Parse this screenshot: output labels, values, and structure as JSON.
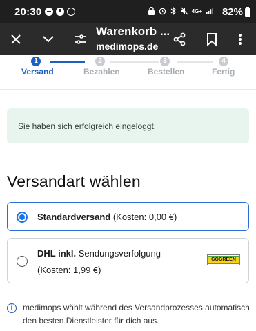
{
  "status_bar": {
    "time": "20:30",
    "network": "4G+",
    "battery": "82%"
  },
  "app_bar": {
    "title": "Warenkorb ...",
    "subtitle": "medimops.de",
    "icons": [
      "close-icon",
      "chevron-down-icon",
      "page-settings-icon",
      "share-icon",
      "bookmark-icon",
      "more-vert-icon"
    ]
  },
  "stepper": {
    "steps": [
      {
        "number": "1",
        "label": "Versand",
        "state": "active"
      },
      {
        "number": "2",
        "label": "Bezahlen",
        "state": "inactive"
      },
      {
        "number": "3",
        "label": "Bestellen",
        "state": "inactive"
      },
      {
        "number": "4",
        "label": "Fertig",
        "state": "inactive"
      }
    ],
    "active_color": "#1f5fbf",
    "inactive_color": "#c9ccd1"
  },
  "notice": {
    "text": "Sie haben sich erfolgreich eingeloggt."
  },
  "shipping": {
    "heading": "Versandart wählen",
    "options": [
      {
        "name": "Standardversand",
        "detail": "(Kosten: 0,00 €)",
        "selected": true
      },
      {
        "name": "DHL inkl.",
        "detail": "Sendungsverfolgung",
        "cost": "(Kosten: 1,99 €)",
        "selected": false,
        "badge": "GOGREEN"
      }
    ]
  },
  "info": {
    "text": "medimops wählt während des Versandprozesses automatisch den besten Dienstleister für dich aus."
  }
}
